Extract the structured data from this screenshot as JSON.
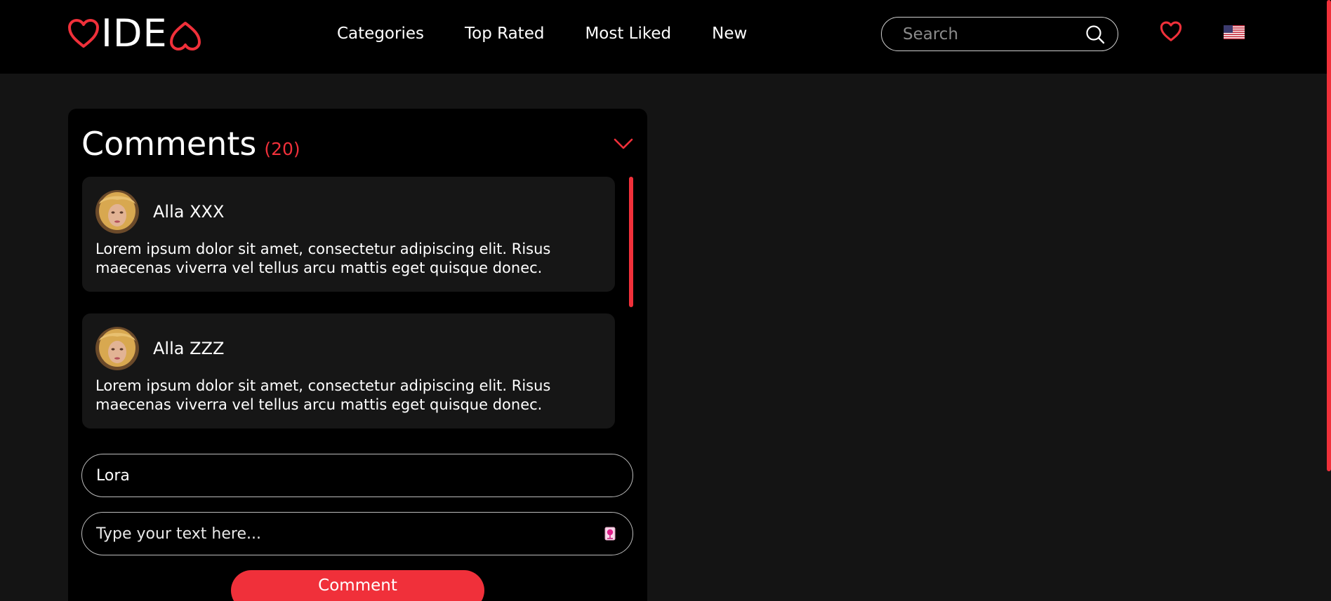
{
  "logo": {
    "text": "IDE"
  },
  "nav": {
    "items": [
      "Categories",
      "Top Rated",
      "Most Liked",
      "New"
    ]
  },
  "search": {
    "placeholder": "Search"
  },
  "icons": {
    "favorites": "heart-outline-icon",
    "language": "us-flag-icon",
    "search": "search-icon",
    "collapse": "chevron-down-icon",
    "emoji": "emoji-icon"
  },
  "colors": {
    "accent": "#f0303a",
    "background": "#141414",
    "header": "#000000",
    "card": "#000000",
    "comment_bg": "#161616"
  },
  "comments": {
    "title": "Comments",
    "count": "(20)",
    "items": [
      {
        "author": "Alla XXX",
        "text": "Lorem ipsum dolor sit amet, consectetur adipiscing elit. Risus maecenas viverra vel tellus arcu mattis eget quisque donec."
      },
      {
        "author": "Alla ZZZ",
        "text": "Lorem ipsum dolor sit amet, consectetur adipiscing elit. Risus maecenas viverra vel tellus arcu mattis eget quisque donec."
      }
    ]
  },
  "form": {
    "name_value": "Lora",
    "text_placeholder": "Type your text here...",
    "submit_label": "Comment"
  }
}
